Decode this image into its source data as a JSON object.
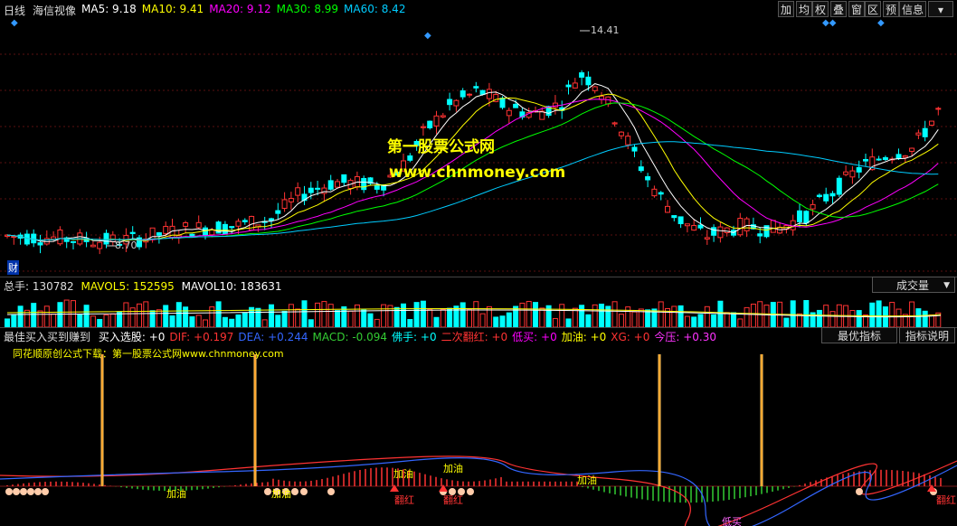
{
  "topbar": {
    "period": "日线",
    "stock_name": "海信视像",
    "ma": [
      {
        "label": "MA5:",
        "value": "9.18",
        "color": "#ffffff"
      },
      {
        "label": "MA10:",
        "value": "9.41",
        "color": "#ffff00"
      },
      {
        "label": "MA20:",
        "value": "9.12",
        "color": "#ff00ff"
      },
      {
        "label": "MA30:",
        "value": "8.99",
        "color": "#00ff00"
      },
      {
        "label": "MA60:",
        "value": "8.42",
        "color": "#00ccff"
      }
    ],
    "buttons": [
      "加",
      "均",
      "权",
      "叠",
      "窗",
      "区",
      "预",
      "信息"
    ]
  },
  "main_chart": {
    "watermark_title": "第一股票公式网",
    "watermark_url": "www.chnmoney.com",
    "high_label": "14.41",
    "low_label": "8.70",
    "cai_label": "财"
  },
  "volume_panel": {
    "total_label": "总手:",
    "total_value": "130782",
    "mavol5_label": "MAVOL5:",
    "mavol5_value": "152595",
    "mavol10_label": "MAVOL10:",
    "mavol10_value": "183631",
    "dropdown_value": "成交量"
  },
  "indicator_panel": {
    "name": "最佳买入买到赚到",
    "fields": [
      {
        "label": "买入选股:",
        "value": "+0",
        "color": "#ffffff"
      },
      {
        "label": "DIF:",
        "value": "+0.197",
        "color": "#ff3333"
      },
      {
        "label": "DEA:",
        "value": "+0.244",
        "color": "#3366ff"
      },
      {
        "label": "MACD:",
        "value": "-0.094",
        "color": "#33cc33"
      },
      {
        "label": "佛手:",
        "value": "+0",
        "color": "#00ffff"
      },
      {
        "label": "二次翻红:",
        "value": "+0",
        "color": "#ff3333"
      },
      {
        "label": "低买:",
        "value": "+0",
        "color": "#ff00ff"
      },
      {
        "label": "加油:",
        "value": "+0",
        "color": "#ffff00"
      },
      {
        "label": "XG:",
        "value": "+0",
        "color": "#ff3333"
      },
      {
        "label": "今压:",
        "value": "+0.30",
        "color": "#ff33ff"
      }
    ],
    "best_indicator_button": "最优指标",
    "explain_button": "指标说明",
    "source_note": "同花顺原创公式下载：第一股票公式网www.chnmoney.com",
    "annotations": [
      "加油",
      "加油",
      "加油",
      "加油",
      "加油",
      "翻红",
      "翻红",
      "翻红",
      "低买"
    ]
  },
  "colors": {
    "up": "#ff3333",
    "down": "#00ffff",
    "grid": "#7a1a1a",
    "watermark": "#ffff00"
  }
}
